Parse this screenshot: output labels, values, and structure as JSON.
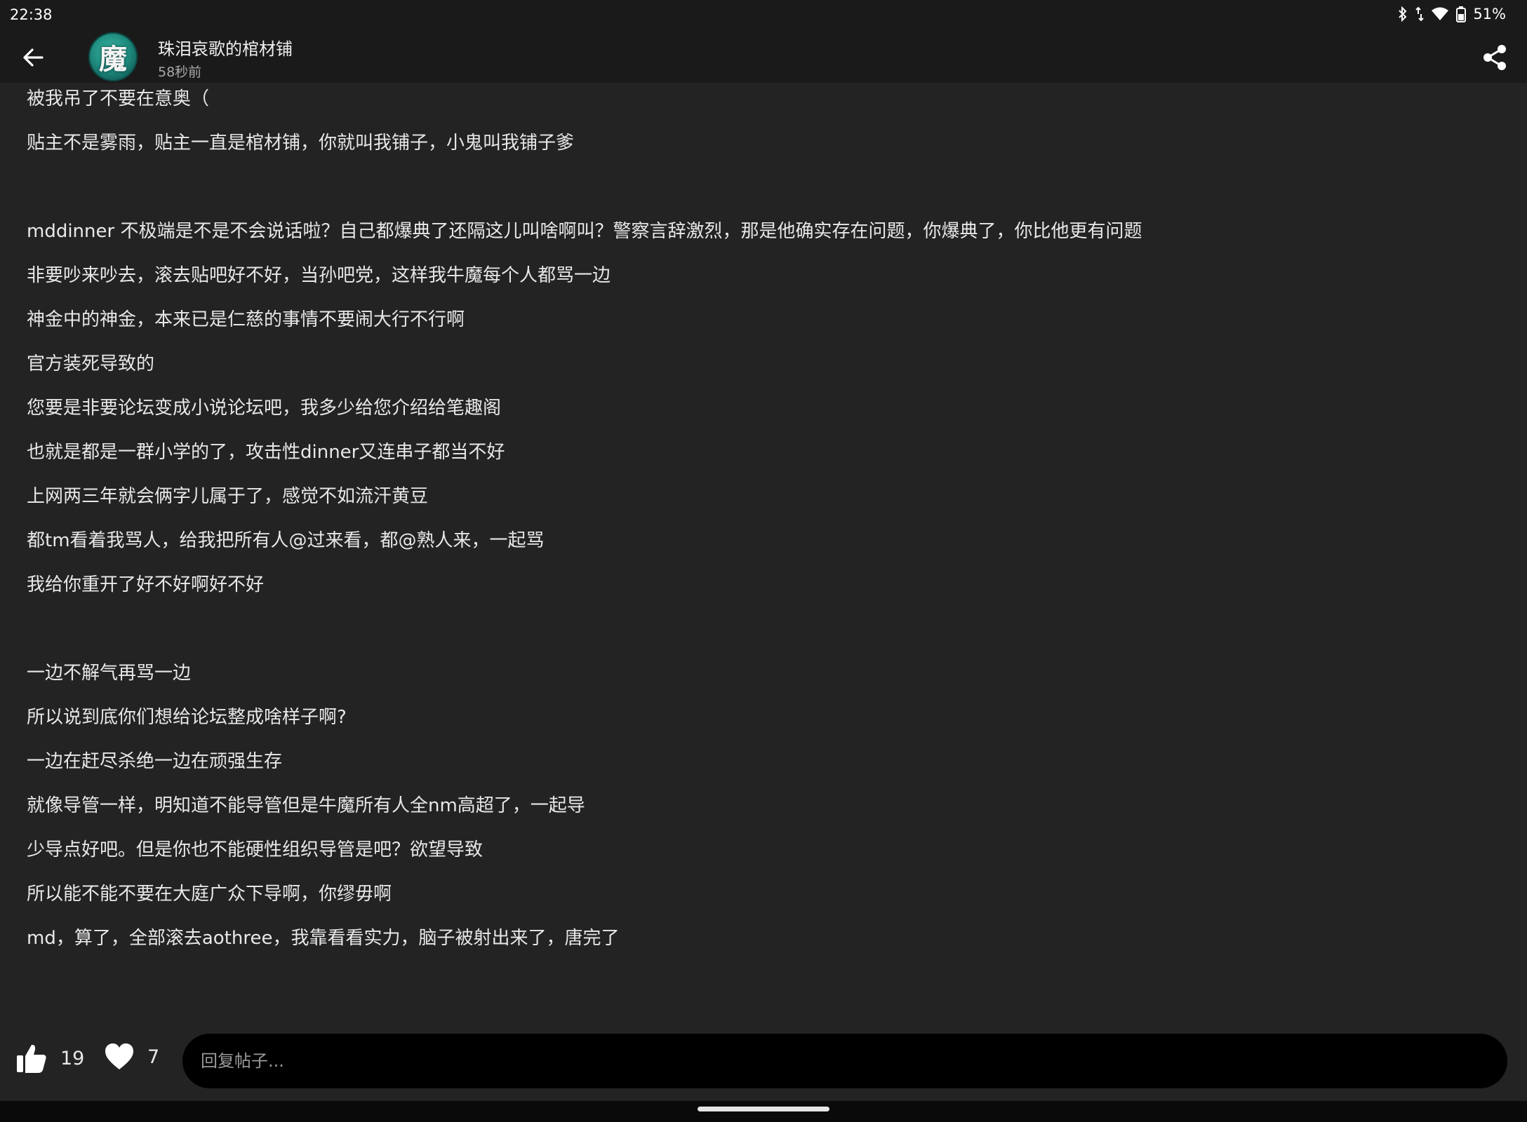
{
  "status_bar": {
    "time": "22:38",
    "battery": "51%",
    "icons": [
      "bluetooth-icon",
      "data-arrows-icon",
      "wifi-icon",
      "battery-icon"
    ]
  },
  "header": {
    "back_icon": "arrow-left-icon",
    "author_name": "珠泪哀歌的棺材铺",
    "avatar_glyph": "魔",
    "post_time": "58秒前",
    "share_icon": "share-icon"
  },
  "post": {
    "lines": [
      "被我吊了不要在意奥（",
      "贴主不是雾雨，贴主一直是棺材铺，你就叫我铺子，小鬼叫我铺子爹",
      "",
      "mddinner 不极端是不是不会说话啦？自己都爆典了还隔这儿叫啥啊叫？警察言辞激烈，那是他确实存在问题，你爆典了，你比他更有问题",
      "非要吵来吵去，滚去贴吧好不好，当孙吧党，这样我牛魔每个人都骂一边",
      "神金中的神金，本来已是仁慈的事情不要闹大行不行啊",
      "官方装死导致的",
      "您要是非要论坛变成小说论坛吧，我多少给您介绍给笔趣阁",
      "也就是都是一群小学的了，攻击性dinner又连串子都当不好",
      "上网两三年就会俩字儿属于了，感觉不如流汗黄豆",
      "都tm看着我骂人，给我把所有人@过来看，都@熟人来，一起骂",
      "我给你重开了好不好啊好不好",
      "",
      "一边不解气再骂一边",
      "所以说到底你们想给论坛整成啥样子啊?",
      "一边在赶尽杀绝一边在顽强生存",
      "就像导管一样，明知道不能导管但是牛魔所有人全nm高超了，一起导",
      "少导点好吧。但是你也不能硬性组织导管是吧？欲望导致",
      "所以能不能不要在大庭广众下导啊，你缪毋啊",
      "md，算了，全部滚去aothree，我靠看看实力，脑子被射出来了，唐完了"
    ]
  },
  "footer": {
    "like_icon": "thumbs-up-icon",
    "like_count": "19",
    "fav_icon": "heart-icon",
    "fav_count": "7",
    "reply_placeholder": "回复帖子..."
  },
  "colors": {
    "background": "#232323",
    "bar": "#1a1a1a",
    "text": "#e8e8e8",
    "input_bg": "#000000"
  }
}
